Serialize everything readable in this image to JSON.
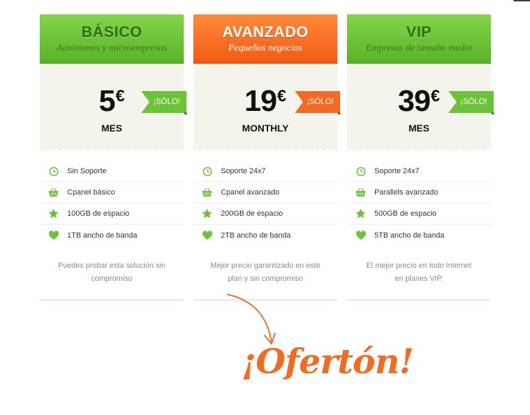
{
  "colors": {
    "green": "#6bc337",
    "orange": "#f56a22"
  },
  "plans": [
    {
      "name": "BÁSICO",
      "subtitle": "Autónomos y microempresas",
      "price": "5",
      "currency": "€",
      "period": "MES",
      "badge": "¡SÓLO!",
      "theme": "green",
      "features": [
        {
          "icon": "clock-icon",
          "label": "Sin Soporte"
        },
        {
          "icon": "basket-icon",
          "label": "Cpanel básico"
        },
        {
          "icon": "star-icon",
          "label": "100GB de espacio"
        },
        {
          "icon": "heart-icon",
          "label": "1TB ancho de banda"
        }
      ],
      "description": "Puedes probar esta solución sin compromiso"
    },
    {
      "name": "AVANZADO",
      "subtitle": "Pequeños negocios",
      "price": "19",
      "currency": "€",
      "period": "MONTHLY",
      "badge": "¡SÓLO!",
      "theme": "orange",
      "features": [
        {
          "icon": "clock-icon",
          "label": "Soporte 24x7"
        },
        {
          "icon": "basket-icon",
          "label": "Cpanel avanzado"
        },
        {
          "icon": "star-icon",
          "label": "200GB de espacio"
        },
        {
          "icon": "heart-icon",
          "label": "2TB ancho de banda"
        }
      ],
      "description": "Mejor precio garantizado en este plan y sin compromiso"
    },
    {
      "name": "VIP",
      "subtitle": "Empresas de tamaño medio",
      "price": "39",
      "currency": "€",
      "period": "MES",
      "badge": "¡SÓLO!",
      "theme": "green",
      "features": [
        {
          "icon": "clock-icon",
          "label": "Soporte 24x7"
        },
        {
          "icon": "basket-icon",
          "label": "Parallels avanzado"
        },
        {
          "icon": "star-icon",
          "label": "500GB de espacio"
        },
        {
          "icon": "heart-icon",
          "label": "5TB ancho de banda"
        }
      ],
      "description": "El mejor precio en todo Internet en planes VIP."
    }
  ],
  "promo": {
    "text": "¡Ofertón!"
  }
}
